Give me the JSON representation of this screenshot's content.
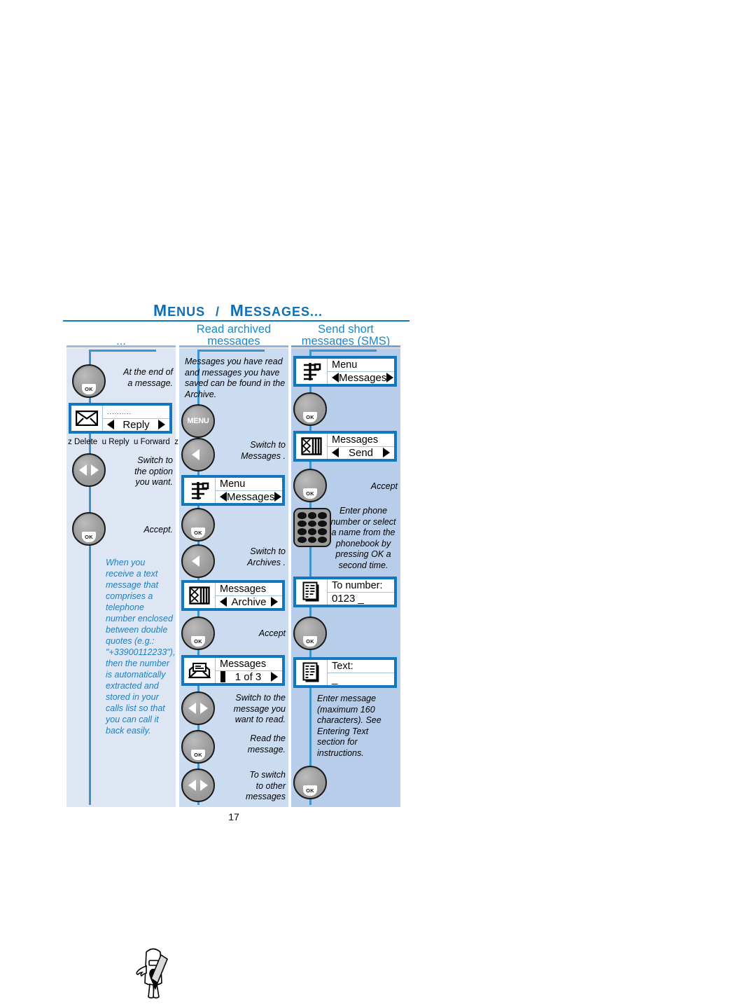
{
  "document": {
    "title": "MENUS / MESSAGES...",
    "title_parts": {
      "word1": "M",
      "word1_rest": "ENUS",
      "slash": "/",
      "word2": "M",
      "word2_rest": "ESSAGES..."
    },
    "page_number": "17"
  },
  "columns": [
    {
      "id": "continued",
      "heading": "...",
      "background": "#dee6f4",
      "steps": [
        {
          "kind": "key",
          "icon": "ok-key-icon",
          "note": "At the end of\na message."
        },
        {
          "kind": "screen",
          "icon": "envelope-icon",
          "line1": "..........",
          "line2": "Reply",
          "arrows": "both"
        },
        {
          "kind": "options",
          "text": "z Delete  u Reply  u Forward  z",
          "items": [
            "Delete",
            "Reply",
            "Forward"
          ]
        },
        {
          "kind": "key",
          "icon": "left-right-key-icon",
          "note": "Switch to\nthe option\nyou want."
        },
        {
          "kind": "key",
          "icon": "ok-key-icon",
          "note": "Accept."
        },
        {
          "kind": "tip",
          "icon": "mascot-icon",
          "text": "When you receive a text message that comprises a telephone number enclosed between double quotes (e.g.: \"+33900112233\"), then the number is automatically extracted and stored in your calls list so that you can call it back easily."
        }
      ]
    },
    {
      "id": "read-archived",
      "heading": "Read archived\nmessages",
      "heading_line1": "Read archived",
      "heading_line2": "messages",
      "background": "#ccdcf0",
      "steps": [
        {
          "kind": "note",
          "text": "Messages you have read and messages you have saved can be found in the Archive."
        },
        {
          "kind": "key",
          "icon": "menu-key-icon",
          "note": ""
        },
        {
          "kind": "key",
          "icon": "left-key-icon",
          "note": "Switch to\nMessages ."
        },
        {
          "kind": "screen",
          "icon": "menu-tree-icon",
          "line1": "Menu",
          "line2": "Messages",
          "arrows": "both"
        },
        {
          "kind": "key",
          "icon": "ok-key-icon",
          "note": ""
        },
        {
          "kind": "key",
          "icon": "left-key-icon",
          "note": "Switch to\nArchives ."
        },
        {
          "kind": "screen",
          "icon": "archive-box-icon",
          "line1": "Messages",
          "line2": "Archive",
          "arrows": "both"
        },
        {
          "kind": "key",
          "icon": "ok-key-icon",
          "note": "Accept"
        },
        {
          "kind": "screen",
          "icon": "open-envelope-icon",
          "line1": "Messages",
          "line2": "1 of 3",
          "arrows": "bar-right"
        },
        {
          "kind": "key",
          "icon": "left-right-key-icon",
          "note": "Switch to the\nmessage you\nwant to read."
        },
        {
          "kind": "key",
          "icon": "ok-key-icon",
          "note": "Read the\nmessage."
        },
        {
          "kind": "key",
          "icon": "left-right-key-icon",
          "note": "To switch\nto other\nmessages"
        }
      ]
    },
    {
      "id": "send-sms",
      "heading": "Send short\nmessages (SMS)",
      "heading_line1": "Send short",
      "heading_line2": "messages (SMS)",
      "background": "#b7cdea",
      "steps": [
        {
          "kind": "screen",
          "icon": "menu-tree-icon",
          "line1": "Menu",
          "line2": "Messages",
          "arrows": "both"
        },
        {
          "kind": "key",
          "icon": "ok-key-icon",
          "note": ""
        },
        {
          "kind": "screen",
          "icon": "archive-box-icon",
          "line1": "Messages",
          "line2": "Send",
          "arrows": "both"
        },
        {
          "kind": "key",
          "icon": "ok-key-icon",
          "note": "Accept"
        },
        {
          "kind": "keypad",
          "icon": "keypad-icon",
          "note": "Enter phone number or  select a name from the phonebook by pressing OK a second time."
        },
        {
          "kind": "screen",
          "icon": "document-icon",
          "line1": "To number:",
          "line2": "0123 _",
          "arrows": "none"
        },
        {
          "kind": "key",
          "icon": "ok-key-icon",
          "note": ""
        },
        {
          "kind": "screen",
          "icon": "document-icon",
          "line1": "Text:",
          "line2": "_",
          "arrows": "none"
        },
        {
          "kind": "note",
          "text": "Enter message (maximum 160 characters). See  Entering Text section for instructions."
        },
        {
          "kind": "key",
          "icon": "ok-key-icon",
          "note": ""
        }
      ]
    }
  ],
  "notes": {
    "c1_step1": "At the end of\na message.",
    "c1_step1_l1": "At the end of",
    "c1_step1_l2": "a message.",
    "c1_options": "z Delete  u Reply  u Forward  z",
    "c1_step2_l1": "Switch to",
    "c1_step2_l2": "the option",
    "c1_step2_l3": "you want.",
    "c1_step3": "Accept.",
    "c1_tip": "When you receive a text message that comprises a telephone number enclosed between double quotes (e.g.: \"+33900112233\"), then the number is automatically extracted and stored in your calls list so that you can call it back easily.",
    "c2_intro": "Messages you have read and messages you have saved can be found in the Archive.",
    "c2_switch_messages_l1": "Switch to",
    "c2_switch_messages_l2": "Messages .",
    "c2_switch_archives_l1": "Switch to",
    "c2_switch_archives_l2": "Archives .",
    "c2_accept": "Accept",
    "c2_switch_msg_l1": "Switch to the",
    "c2_switch_msg_l2": "message you",
    "c2_switch_msg_l3": "want to read.",
    "c2_read_l1": "Read the",
    "c2_read_l2": "message.",
    "c2_toswitch_l1": "To switch",
    "c2_toswitch_l2": "to other",
    "c2_toswitch_l3": "messages",
    "c3_accept": "Accept",
    "c3_enterphone": "Enter phone number or  select a name from the phonebook by pressing OK a second time.",
    "c3_entermsg": "Enter message (maximum 160 characters). See  Entering Text section for instructions."
  },
  "screens": {
    "reply": {
      "line1": "..........",
      "line2": "Reply"
    },
    "menu_msgs1": {
      "line1": "Menu",
      "line2": "Messages"
    },
    "msgs_arch": {
      "line1": "Messages",
      "line2": "Archive"
    },
    "msgs_1of3": {
      "line1": "Messages",
      "line2": "1 of 3"
    },
    "menu_msgs2": {
      "line1": "Menu",
      "line2": "Messages"
    },
    "msgs_send": {
      "line1": "Messages",
      "line2": "Send"
    },
    "to_number": {
      "line1": "To number:",
      "line2": "0123 _"
    },
    "text": {
      "line1": "Text:",
      "line2": "_"
    }
  },
  "keys": {
    "ok_label": "OK",
    "menu_label": "MENU"
  },
  "options_row": {
    "marker_left": "z",
    "delete": "Delete",
    "sep1": "u",
    "reply": "Reply",
    "sep2": "u",
    "forward": "Forward",
    "marker_right": "z"
  },
  "colors": {
    "accent_blue": "#1277bd",
    "heading_blue": "#1b86c8",
    "spine_blue": "#3d92d0",
    "col1_bg": "#dee6f4",
    "col2_bg": "#ccdcf0",
    "col3_bg": "#b7cdea",
    "key_gray": "#9b9b9b"
  }
}
